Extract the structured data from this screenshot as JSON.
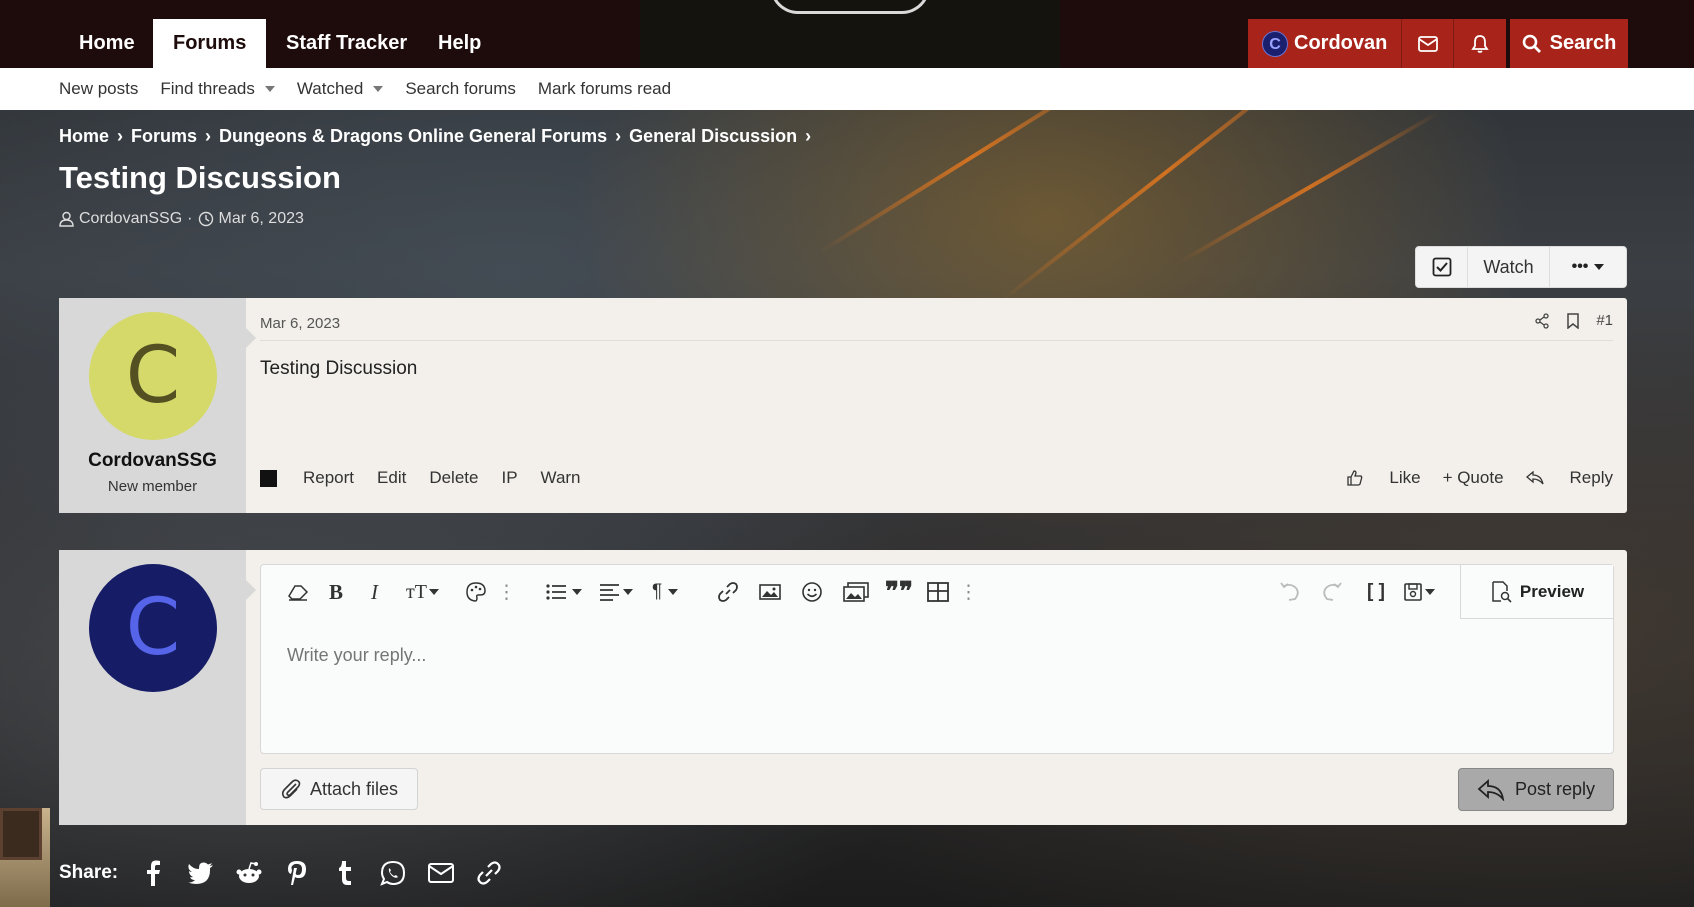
{
  "nav": {
    "tabs": [
      {
        "label": "Home"
      },
      {
        "label": "Forums"
      },
      {
        "label": "Staff Tracker"
      },
      {
        "label": "Help"
      }
    ],
    "active_tab": "Forums",
    "user": {
      "name": "Cordovan",
      "avatar_letter": "C"
    },
    "search_label": "Search"
  },
  "subnav": {
    "items": [
      "New posts",
      "Find threads",
      "Watched",
      "Search forums",
      "Mark forums read"
    ]
  },
  "breadcrumb": [
    "Home",
    "Forums",
    "Dungeons & Dragons Online General Forums",
    "General Discussion"
  ],
  "thread": {
    "title": "Testing Discussion",
    "author": "CordovanSSG",
    "date": "Mar 6, 2023",
    "watch_label": "Watch",
    "more_label": "•••"
  },
  "post": {
    "avatar_letter": "C",
    "username": "CordovanSSG",
    "user_title": "New member",
    "date": "Mar 6, 2023",
    "number": "#1",
    "body": "Testing Discussion",
    "actions": [
      "Report",
      "Edit",
      "Delete",
      "IP",
      "Warn"
    ],
    "like": "Like",
    "quote": "+ Quote",
    "reply": "Reply"
  },
  "reply_box": {
    "avatar_letter": "C",
    "placeholder": "Write your reply...",
    "preview": "Preview",
    "attach": "Attach files",
    "post_reply": "Post reply"
  },
  "share": {
    "label": "Share:"
  },
  "colors": {
    "brand_dark": "#1e0b0b",
    "accent_red": "#a8241a",
    "avatar_yellow": "#d4d96a",
    "avatar_blue": "#161d66"
  }
}
